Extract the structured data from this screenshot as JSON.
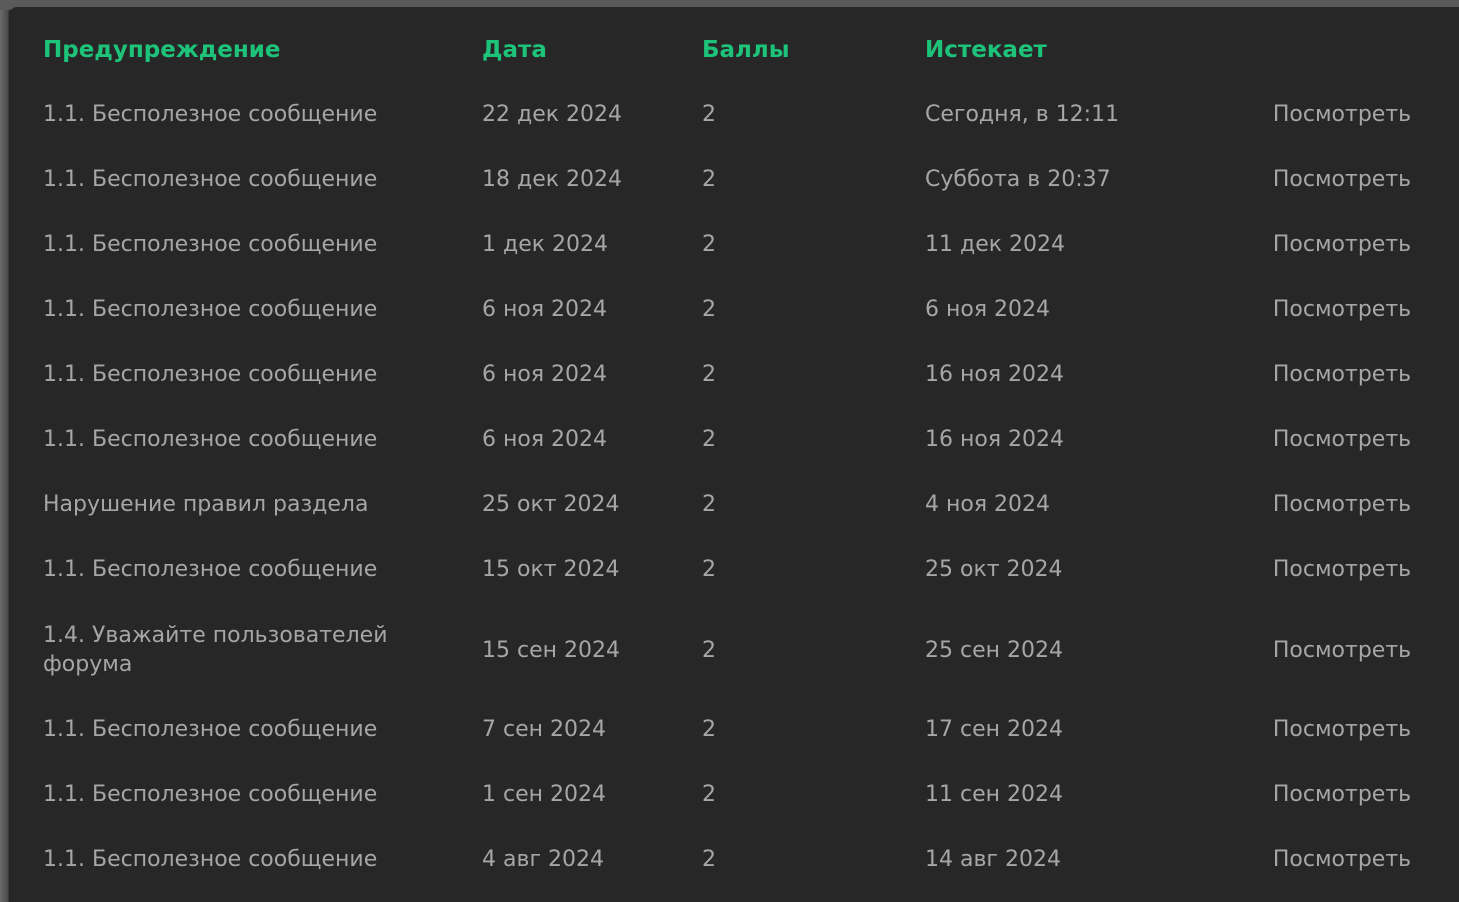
{
  "header": {
    "warning": "Предупреждение",
    "date": "Дата",
    "points": "Баллы",
    "expires": "Истекает"
  },
  "rows": [
    {
      "warning": "1.1. Бесполезное сообщение",
      "date": "22 дек 2024",
      "points": "2",
      "expires": "Сегодня, в 12:11",
      "action": "Посмотреть"
    },
    {
      "warning": "1.1. Бесполезное сообщение",
      "date": "18 дек 2024",
      "points": "2",
      "expires": "Суббота в 20:37",
      "action": "Посмотреть"
    },
    {
      "warning": "1.1. Бесполезное сообщение",
      "date": "1 дек 2024",
      "points": "2",
      "expires": "11 дек 2024",
      "action": "Посмотреть"
    },
    {
      "warning": "1.1. Бесполезное сообщение",
      "date": "6 ноя 2024",
      "points": "2",
      "expires": "6 ноя 2024",
      "action": "Посмотреть"
    },
    {
      "warning": "1.1. Бесполезное сообщение",
      "date": "6 ноя 2024",
      "points": "2",
      "expires": "16 ноя 2024",
      "action": "Посмотреть"
    },
    {
      "warning": "1.1. Бесполезное сообщение",
      "date": "6 ноя 2024",
      "points": "2",
      "expires": "16 ноя 2024",
      "action": "Посмотреть"
    },
    {
      "warning": "Нарушение правил раздела",
      "date": "25 окт 2024",
      "points": "2",
      "expires": "4 ноя 2024",
      "action": "Посмотреть"
    },
    {
      "warning": "1.1. Бесполезное сообщение",
      "date": "15 окт 2024",
      "points": "2",
      "expires": "25 окт 2024",
      "action": "Посмотреть"
    },
    {
      "warning": "1.4. Уважайте пользователей форума",
      "date": "15 сен 2024",
      "points": "2",
      "expires": "25 сен 2024",
      "action": "Посмотреть"
    },
    {
      "warning": "1.1. Бесполезное сообщение",
      "date": "7 сен 2024",
      "points": "2",
      "expires": "17 сен 2024",
      "action": "Посмотреть"
    },
    {
      "warning": "1.1. Бесполезное сообщение",
      "date": "1 сен 2024",
      "points": "2",
      "expires": "11 сен 2024",
      "action": "Посмотреть"
    },
    {
      "warning": "1.1. Бесполезное сообщение",
      "date": "4 авг 2024",
      "points": "2",
      "expires": "14 авг 2024",
      "action": "Посмотреть"
    }
  ],
  "colors": {
    "header_text": "#1ec37a",
    "body_text": "#a6a6a6",
    "panel_bg": "#272727"
  }
}
